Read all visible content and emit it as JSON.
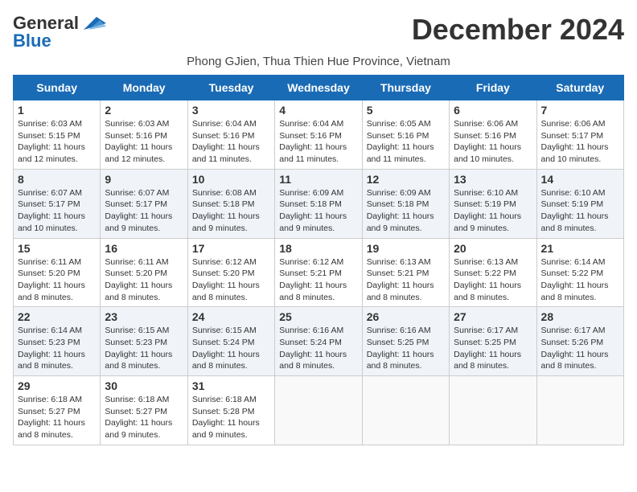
{
  "header": {
    "logo_general": "General",
    "logo_blue": "Blue",
    "month_title": "December 2024",
    "subtitle": "Phong GJien, Thua Thien Hue Province, Vietnam"
  },
  "days_of_week": [
    "Sunday",
    "Monday",
    "Tuesday",
    "Wednesday",
    "Thursday",
    "Friday",
    "Saturday"
  ],
  "weeks": [
    [
      {
        "day": "1",
        "sunrise": "6:03 AM",
        "sunset": "5:15 PM",
        "daylight": "11 hours and 12 minutes."
      },
      {
        "day": "2",
        "sunrise": "6:03 AM",
        "sunset": "5:16 PM",
        "daylight": "11 hours and 12 minutes."
      },
      {
        "day": "3",
        "sunrise": "6:04 AM",
        "sunset": "5:16 PM",
        "daylight": "11 hours and 11 minutes."
      },
      {
        "day": "4",
        "sunrise": "6:04 AM",
        "sunset": "5:16 PM",
        "daylight": "11 hours and 11 minutes."
      },
      {
        "day": "5",
        "sunrise": "6:05 AM",
        "sunset": "5:16 PM",
        "daylight": "11 hours and 11 minutes."
      },
      {
        "day": "6",
        "sunrise": "6:06 AM",
        "sunset": "5:16 PM",
        "daylight": "11 hours and 10 minutes."
      },
      {
        "day": "7",
        "sunrise": "6:06 AM",
        "sunset": "5:17 PM",
        "daylight": "11 hours and 10 minutes."
      }
    ],
    [
      {
        "day": "8",
        "sunrise": "6:07 AM",
        "sunset": "5:17 PM",
        "daylight": "11 hours and 10 minutes."
      },
      {
        "day": "9",
        "sunrise": "6:07 AM",
        "sunset": "5:17 PM",
        "daylight": "11 hours and 9 minutes."
      },
      {
        "day": "10",
        "sunrise": "6:08 AM",
        "sunset": "5:18 PM",
        "daylight": "11 hours and 9 minutes."
      },
      {
        "day": "11",
        "sunrise": "6:09 AM",
        "sunset": "5:18 PM",
        "daylight": "11 hours and 9 minutes."
      },
      {
        "day": "12",
        "sunrise": "6:09 AM",
        "sunset": "5:18 PM",
        "daylight": "11 hours and 9 minutes."
      },
      {
        "day": "13",
        "sunrise": "6:10 AM",
        "sunset": "5:19 PM",
        "daylight": "11 hours and 9 minutes."
      },
      {
        "day": "14",
        "sunrise": "6:10 AM",
        "sunset": "5:19 PM",
        "daylight": "11 hours and 8 minutes."
      }
    ],
    [
      {
        "day": "15",
        "sunrise": "6:11 AM",
        "sunset": "5:20 PM",
        "daylight": "11 hours and 8 minutes."
      },
      {
        "day": "16",
        "sunrise": "6:11 AM",
        "sunset": "5:20 PM",
        "daylight": "11 hours and 8 minutes."
      },
      {
        "day": "17",
        "sunrise": "6:12 AM",
        "sunset": "5:20 PM",
        "daylight": "11 hours and 8 minutes."
      },
      {
        "day": "18",
        "sunrise": "6:12 AM",
        "sunset": "5:21 PM",
        "daylight": "11 hours and 8 minutes."
      },
      {
        "day": "19",
        "sunrise": "6:13 AM",
        "sunset": "5:21 PM",
        "daylight": "11 hours and 8 minutes."
      },
      {
        "day": "20",
        "sunrise": "6:13 AM",
        "sunset": "5:22 PM",
        "daylight": "11 hours and 8 minutes."
      },
      {
        "day": "21",
        "sunrise": "6:14 AM",
        "sunset": "5:22 PM",
        "daylight": "11 hours and 8 minutes."
      }
    ],
    [
      {
        "day": "22",
        "sunrise": "6:14 AM",
        "sunset": "5:23 PM",
        "daylight": "11 hours and 8 minutes."
      },
      {
        "day": "23",
        "sunrise": "6:15 AM",
        "sunset": "5:23 PM",
        "daylight": "11 hours and 8 minutes."
      },
      {
        "day": "24",
        "sunrise": "6:15 AM",
        "sunset": "5:24 PM",
        "daylight": "11 hours and 8 minutes."
      },
      {
        "day": "25",
        "sunrise": "6:16 AM",
        "sunset": "5:24 PM",
        "daylight": "11 hours and 8 minutes."
      },
      {
        "day": "26",
        "sunrise": "6:16 AM",
        "sunset": "5:25 PM",
        "daylight": "11 hours and 8 minutes."
      },
      {
        "day": "27",
        "sunrise": "6:17 AM",
        "sunset": "5:25 PM",
        "daylight": "11 hours and 8 minutes."
      },
      {
        "day": "28",
        "sunrise": "6:17 AM",
        "sunset": "5:26 PM",
        "daylight": "11 hours and 8 minutes."
      }
    ],
    [
      {
        "day": "29",
        "sunrise": "6:18 AM",
        "sunset": "5:27 PM",
        "daylight": "11 hours and 8 minutes."
      },
      {
        "day": "30",
        "sunrise": "6:18 AM",
        "sunset": "5:27 PM",
        "daylight": "11 hours and 9 minutes."
      },
      {
        "day": "31",
        "sunrise": "6:18 AM",
        "sunset": "5:28 PM",
        "daylight": "11 hours and 9 minutes."
      },
      null,
      null,
      null,
      null
    ]
  ]
}
